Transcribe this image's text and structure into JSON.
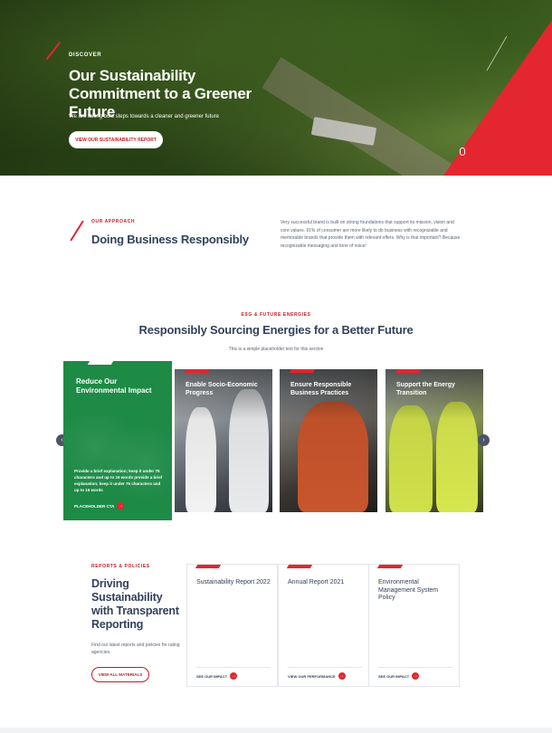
{
  "colors": {
    "accent": "#e3262f",
    "accent_dark": "#c31d25",
    "heading": "#33415a",
    "card_green": "#1d8a46"
  },
  "hero": {
    "eyebrow": "DISCOVER",
    "title": "Our Sustainability Commitment to a Greener Future",
    "subtitle": "We are taking bold steps towards a cleaner and greener future",
    "cta_label": "VIEW OUR SUSTAINABILITY REPORT"
  },
  "approach": {
    "eyebrow": "OUR APPROACH",
    "title": "Doing Business Responsibly",
    "text": "Very successful brand is built on strong foundations that support its mission, vision and core values. 91% of consumer are more likely to do business with recognizable and memorable brands that provide them with relevant offers. Why is that important? Because recognizable messaging and tone of voice!"
  },
  "esg": {
    "eyebrow": "ESG & FUTURE ENERGIES",
    "title": "Responsibly Sourcing Energies for a Better Future",
    "subtitle": "This is a simple placeholder text for this section",
    "cards": [
      {
        "title": "Reduce Our Environmental Impact",
        "body": "Provide a brief explanation; keep it under 75 characters and up to 16 words provide a brief explanation; keep it under 75 characters and up to 16 words",
        "cta": "PLACEHOLDER CTA"
      },
      {
        "title": "Enable Socio-Economic Progress"
      },
      {
        "title": "Ensure Responsible Business Practices"
      },
      {
        "title": "Support the Energy Transition"
      }
    ],
    "nav_prev_icon": "chevron-left-icon",
    "nav_next_icon": "chevron-right-icon"
  },
  "reports": {
    "eyebrow": "REPORTS & POLICIES",
    "title": "Driving Sustainability with Transparent Reporting",
    "subtitle": "Find our latest reports and policies for rating agencies.",
    "cta_label": "VIEW ALL MATERIALS",
    "cards": [
      {
        "title": "Sustainability Report 2022",
        "link": "SEE OUR IMPACT"
      },
      {
        "title": "Annual Report 2021",
        "link": "VIEW OUR PERFORMANCE"
      },
      {
        "title": "Environmental Management System Policy",
        "link": "SEE OUR IMPACT"
      }
    ]
  }
}
